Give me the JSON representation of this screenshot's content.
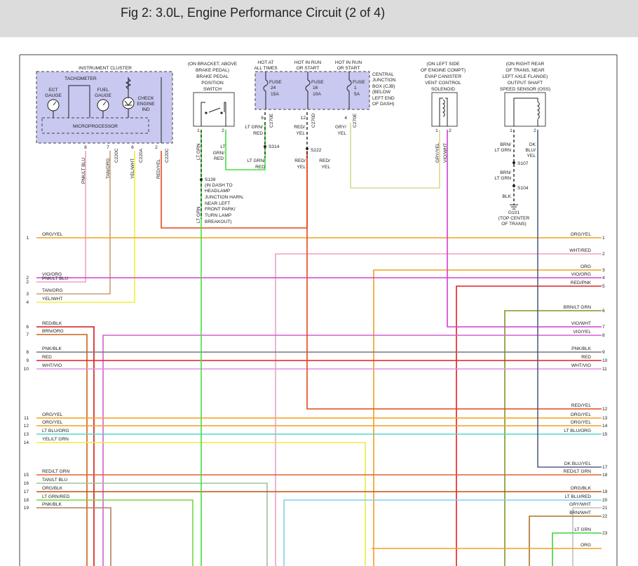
{
  "title": "Fig 2: 3.0L, Engine Performance Circuit (2 of 4)",
  "cluster": {
    "label": "INSTRUMENT CLUSTER",
    "tach": "TACHOMETER",
    "ect1": "ECT",
    "ect2": "GAUGE",
    "fuel1": "FUEL",
    "fuel2": "GAUGE",
    "ce1": "CHECK",
    "ce2": "ENGINE",
    "ce3": "IND",
    "micro": "MICROPROCESSOR",
    "pins": [
      "8",
      "7",
      "6",
      "2"
    ],
    "conns": [
      "C220C",
      "C220A",
      "C220C"
    ],
    "wires": [
      "PNK/LT BLU",
      "TAN/ORG",
      "YEL/WHT",
      "RED/YEL"
    ]
  },
  "brake": {
    "l1": "(ON BRACKET, ABOVE",
    "l2": "BRAKE PEDAL)",
    "l3": "BRAKE PEDAL",
    "l4": "POSITION",
    "l5": "SWITCH",
    "p1": "1",
    "p2": "2",
    "w1": "LT GRN",
    "w2a": "LT",
    "w2b": "GRN/",
    "w2c": "RED"
  },
  "s139": {
    "l1": "S139",
    "l2": "(IN DASH TO",
    "l3": "HEADLAMP",
    "l4": "JUNCTION HARN,",
    "l5": "NEAR LEFT",
    "l6": "FRONT PARK/",
    "l7": "TURN LAMP",
    "l8": "BREAKOUT)",
    "w": "LT GRN"
  },
  "fuses": {
    "h1a": "HOT AT",
    "h1b": "ALL TIMES",
    "h2a": "HOT IN RUN",
    "h2b": "OR START",
    "h3a": "HOT IN RUN",
    "h3b": "OR START",
    "f1a": "FUSE",
    "f1b": "24",
    "f1c": "15A",
    "f2a": "FUSE",
    "f2b": "16",
    "f2c": "10A",
    "f3a": "FUSE",
    "f3b": "1",
    "f3c": "5A",
    "cjb1": "CENTRAL",
    "cjb2": "JUNCTION",
    "cjb3": "BOX (CJB)",
    "cjb4": "(BELOW",
    "cjb5": "LEFT END",
    "cjb6": "OF DASH)",
    "pin1": "6",
    "pin2": "12",
    "pin3": "4",
    "conn1": "C270E",
    "conn2": "C270D",
    "conn3": "C270E",
    "w1a": "LT GRN/",
    "w1b": "RED",
    "w2a": "RED/",
    "w2b": "YEL",
    "w3a": "GRY/",
    "w3b": "YEL",
    "s314": "S314",
    "s222": "S222",
    "w4a": "LT GRN/",
    "w4b": "RED",
    "w5a": "RED/",
    "w5b": "YEL",
    "w6a": "RED/",
    "w6b": "YEL"
  },
  "evap": {
    "l1": "(ON LEFT SIDE",
    "l2": "OF ENGINE COMPT)",
    "l3": "EVAP CANISTER",
    "l4": "VENT CONTROL",
    "l5": "SOLENOID",
    "p1": "1",
    "p2": "2",
    "w1": "GRY/YEL",
    "w2": "VIO/WHT"
  },
  "oss": {
    "l1": "(ON RIGHT REAR",
    "l2": "OF TRANS, NEAR",
    "l3": "LEFT AXLE FLANGE)",
    "l4": "OUTPUT SHAFT",
    "l5": "SPEED SENSOR (OSS)",
    "p1": "1",
    "p2": "2",
    "w1a": "BRN/",
    "w1b": "LT GRN",
    "w2a": "DK",
    "w2b": "BLU/",
    "w2c": "YEL",
    "s107": "S107",
    "w3a": "BRN/",
    "w3b": "LT GRN",
    "s104": "S104",
    "blk": "BLK",
    "g101": "G101",
    "g101b": "(TOP CENTER",
    "g101c": "OF TRANS)"
  },
  "left_rows": [
    {
      "n": "1",
      "w": "ORG/YEL"
    },
    {
      "n": "2",
      "w": "VIO/ORG"
    },
    {
      "n": "2",
      "w": "PNK/LT BLU"
    },
    {
      "n": "3",
      "w": "TAN/ORG"
    },
    {
      "n": "4",
      "w": "YEL/WHT"
    },
    {
      "n": "6",
      "w": "RED/BLK"
    },
    {
      "n": "7",
      "w": "BRN/ORG"
    },
    {
      "n": "8",
      "w": "PNK/BLK"
    },
    {
      "n": "9",
      "w": "RED"
    },
    {
      "n": "10",
      "w": "WHT/VIO"
    },
    {
      "n": "11",
      "w": "ORG/YEL"
    },
    {
      "n": "12",
      "w": "ORG/YEL"
    },
    {
      "n": "13",
      "w": "LT BLU/ORG"
    },
    {
      "n": "14",
      "w": "YEL/LT GRN"
    },
    {
      "n": "15",
      "w": "RED/LT GRN"
    },
    {
      "n": "16",
      "w": "TAN/LT BLU"
    },
    {
      "n": "17",
      "w": "ORG/BLK"
    },
    {
      "n": "18",
      "w": "LT GRN/RED"
    },
    {
      "n": "19",
      "w": "PNK/BLK"
    }
  ],
  "right_rows": [
    {
      "n": "1",
      "w": "ORG/YEL"
    },
    {
      "n": "2",
      "w": "WHT/RED"
    },
    {
      "n": "3",
      "w": "ORG"
    },
    {
      "n": "4",
      "w": "VIO/ORG"
    },
    {
      "n": "5",
      "w": "RED/PNK"
    },
    {
      "n": "6",
      "w": "BRN/LT GRN"
    },
    {
      "n": "7",
      "w": "VIO/WHT"
    },
    {
      "n": "8",
      "w": "VIO/YEL"
    },
    {
      "n": "9",
      "w": "PNK/BLK"
    },
    {
      "n": "10",
      "w": "RED"
    },
    {
      "n": "11",
      "w": "WHT/VIO"
    },
    {
      "n": "12",
      "w": "RED/YEL"
    },
    {
      "n": "13",
      "w": "ORG/YEL"
    },
    {
      "n": "14",
      "w": "ORG/YEL"
    },
    {
      "n": "15",
      "w": "LT BLU/ORG"
    },
    {
      "n": "17",
      "w": "DK BLU/YEL"
    },
    {
      "n": "18",
      "w": "RED/LT GRN"
    },
    {
      "n": "19",
      "w": "ORG/BLK"
    },
    {
      "n": "20",
      "w": "LT BLU/RED"
    },
    {
      "n": "21",
      "w": "GRY/WHT"
    },
    {
      "n": "22",
      "w": "BRN/WHT"
    },
    {
      "n": "23",
      "w": "LT GRN"
    },
    {
      "n": "",
      "w": "ORG"
    }
  ]
}
